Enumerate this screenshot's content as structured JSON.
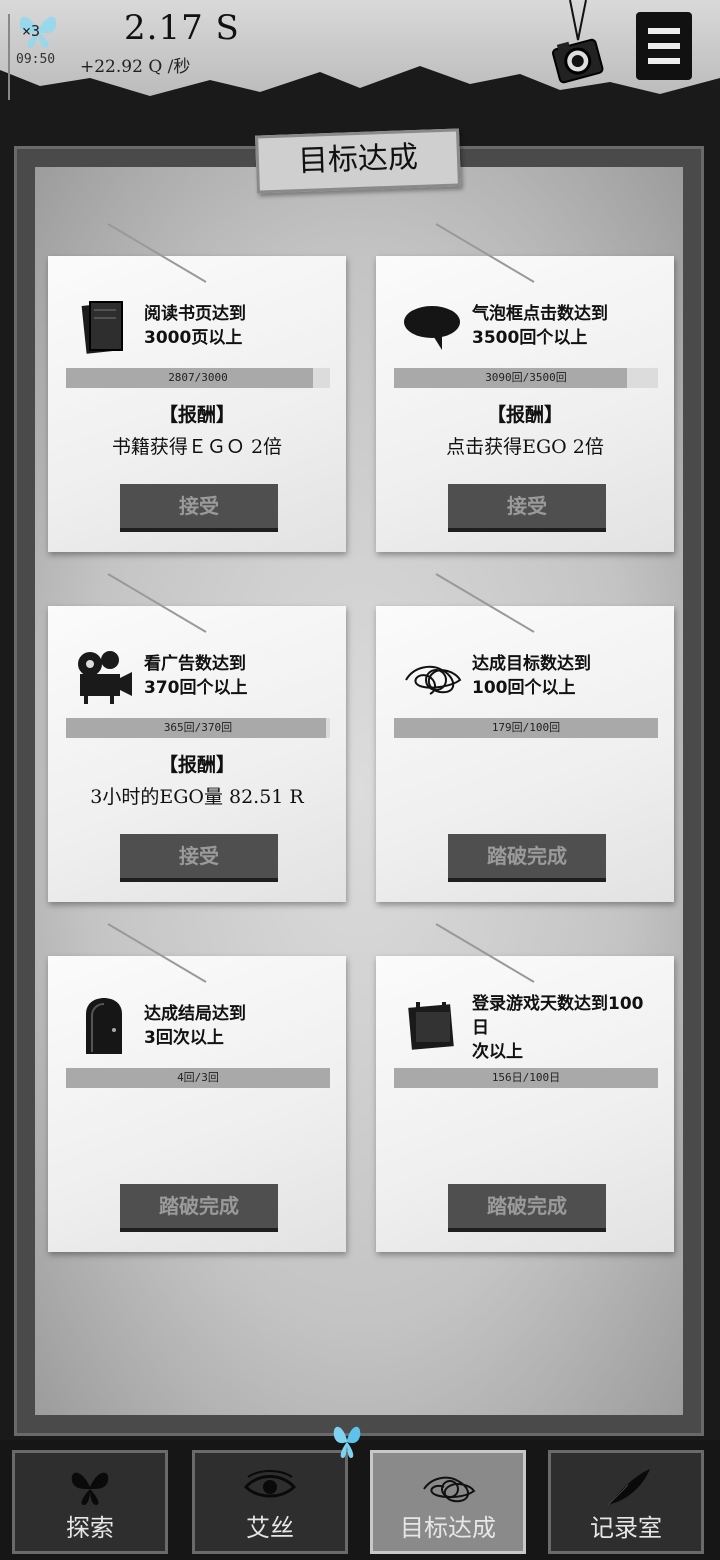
{
  "hud": {
    "multiplier": "×3",
    "time": "09:50",
    "currency": "2.17 S",
    "rate": "+22.92 Q /秒",
    "menu_icon": "menu-icon",
    "camera_icon": "camera-icon"
  },
  "board": {
    "title": "目标达成"
  },
  "cards": [
    {
      "icon": "book-icon",
      "title_line1": "阅读书页达到",
      "title_line2": "3000页以上",
      "progress_text": "2807/3000",
      "progress": 0.936,
      "reward_head": "【报酬】",
      "reward_body": "书籍获得ＥＧＯ 2倍",
      "button": "接受"
    },
    {
      "icon": "speech-bubble-icon",
      "title_line1": "气泡框点击数达到",
      "title_line2": "3500回个以上",
      "progress_text": "3090回/3500回",
      "progress": 0.883,
      "reward_head": "【报酬】",
      "reward_body": "点击获得EGO 2倍",
      "button": "接受"
    },
    {
      "icon": "film-projector-icon",
      "title_line1": "看广告数达到",
      "title_line2": "370回个以上",
      "progress_text": "365回/370回",
      "progress": 0.986,
      "reward_head": "【报酬】",
      "reward_body": "3小时的EGO量 82.51 R",
      "button": "接受"
    },
    {
      "icon": "scribble-goal-icon",
      "title_line1": "达成目标数达到",
      "title_line2": "100回个以上",
      "progress_text": "179回/100回",
      "progress": 1.0,
      "reward_head": "",
      "reward_body": "",
      "button": "踏破完成"
    },
    {
      "icon": "door-icon",
      "title_line1": "达成结局达到",
      "title_line2": "3回次以上",
      "progress_text": "4回/3回",
      "progress": 1.0,
      "reward_head": "",
      "reward_body": "",
      "button": "踏破完成"
    },
    {
      "icon": "calendar-icon",
      "title_line1": "登录游戏天数达到100",
      "title_line2": "日",
      "title_line3": "次以上",
      "progress_text": "156日/100日",
      "progress": 1.0,
      "reward_head": "",
      "reward_body": "",
      "button": "踏破完成"
    }
  ],
  "nav": [
    {
      "label": "探索",
      "icon": "butterfly-icon",
      "active": false
    },
    {
      "label": "艾丝",
      "icon": "eye-icon",
      "active": false
    },
    {
      "label": "目标达成",
      "icon": "scribble-icon",
      "active": true
    },
    {
      "label": "记录室",
      "icon": "quill-icon",
      "active": false
    }
  ]
}
